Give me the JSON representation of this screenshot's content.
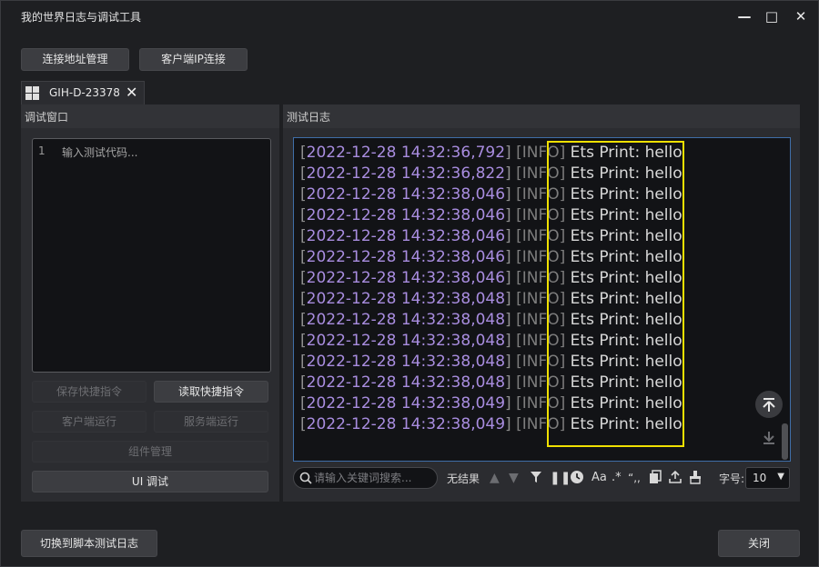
{
  "window": {
    "title": "我的世界日志与调试工具",
    "controls": [
      "—",
      "□",
      "✕"
    ]
  },
  "top_buttons": [
    "连接地址管理",
    "客户端IP连接"
  ],
  "tab": {
    "label": "GIH-D-23378"
  },
  "debug_panel": {
    "title": "调试窗口",
    "editor": {
      "line_number": "1",
      "placeholder": "输入测试代码..."
    },
    "buttons": {
      "save_shortcut": "保存快捷指令",
      "read_shortcut": "读取快捷指令",
      "client_run": "客户端运行",
      "server_run": "服务端运行",
      "component_mgmt": "组件管理",
      "ui_debug": "UI 调试"
    }
  },
  "log_panel": {
    "title": "测试日志",
    "lines": [
      {
        "ts": "2022-12-28 14:32:36,792",
        "level": "INFO",
        "msg": "Ets Print: hello"
      },
      {
        "ts": "2022-12-28 14:32:36,822",
        "level": "INFO",
        "msg": "Ets Print: hello"
      },
      {
        "ts": "2022-12-28 14:32:38,046",
        "level": "INFO",
        "msg": "Ets Print: hello"
      },
      {
        "ts": "2022-12-28 14:32:38,046",
        "level": "INFO",
        "msg": "Ets Print: hello"
      },
      {
        "ts": "2022-12-28 14:32:38,046",
        "level": "INFO",
        "msg": "Ets Print: hello"
      },
      {
        "ts": "2022-12-28 14:32:38,046",
        "level": "INFO",
        "msg": "Ets Print: hello"
      },
      {
        "ts": "2022-12-28 14:32:38,046",
        "level": "INFO",
        "msg": "Ets Print: hello"
      },
      {
        "ts": "2022-12-28 14:32:38,048",
        "level": "INFO",
        "msg": "Ets Print: hello"
      },
      {
        "ts": "2022-12-28 14:32:38,048",
        "level": "INFO",
        "msg": "Ets Print: hello"
      },
      {
        "ts": "2022-12-28 14:32:38,048",
        "level": "INFO",
        "msg": "Ets Print: hello"
      },
      {
        "ts": "2022-12-28 14:32:38,048",
        "level": "INFO",
        "msg": "Ets Print: hello"
      },
      {
        "ts": "2022-12-28 14:32:38,048",
        "level": "INFO",
        "msg": "Ets Print: hello"
      },
      {
        "ts": "2022-12-28 14:32:38,049",
        "level": "INFO",
        "msg": "Ets Print: hello"
      },
      {
        "ts": "2022-12-28 14:32:38,049",
        "level": "INFO",
        "msg": "Ets Print: hello"
      }
    ],
    "highlight_color": "#f0e000",
    "accent_color": "#a98de0"
  },
  "toolbar": {
    "search_placeholder": "请输入关键词搜索...",
    "result_text": "无结果",
    "font_size_label": "字号:",
    "font_size_value": "10",
    "case_label": "Aa",
    "regex_label": ".*",
    "quote_label": "“,,"
  },
  "footer": {
    "switch_button": "切换到脚本测试日志",
    "close_button": "关闭"
  }
}
